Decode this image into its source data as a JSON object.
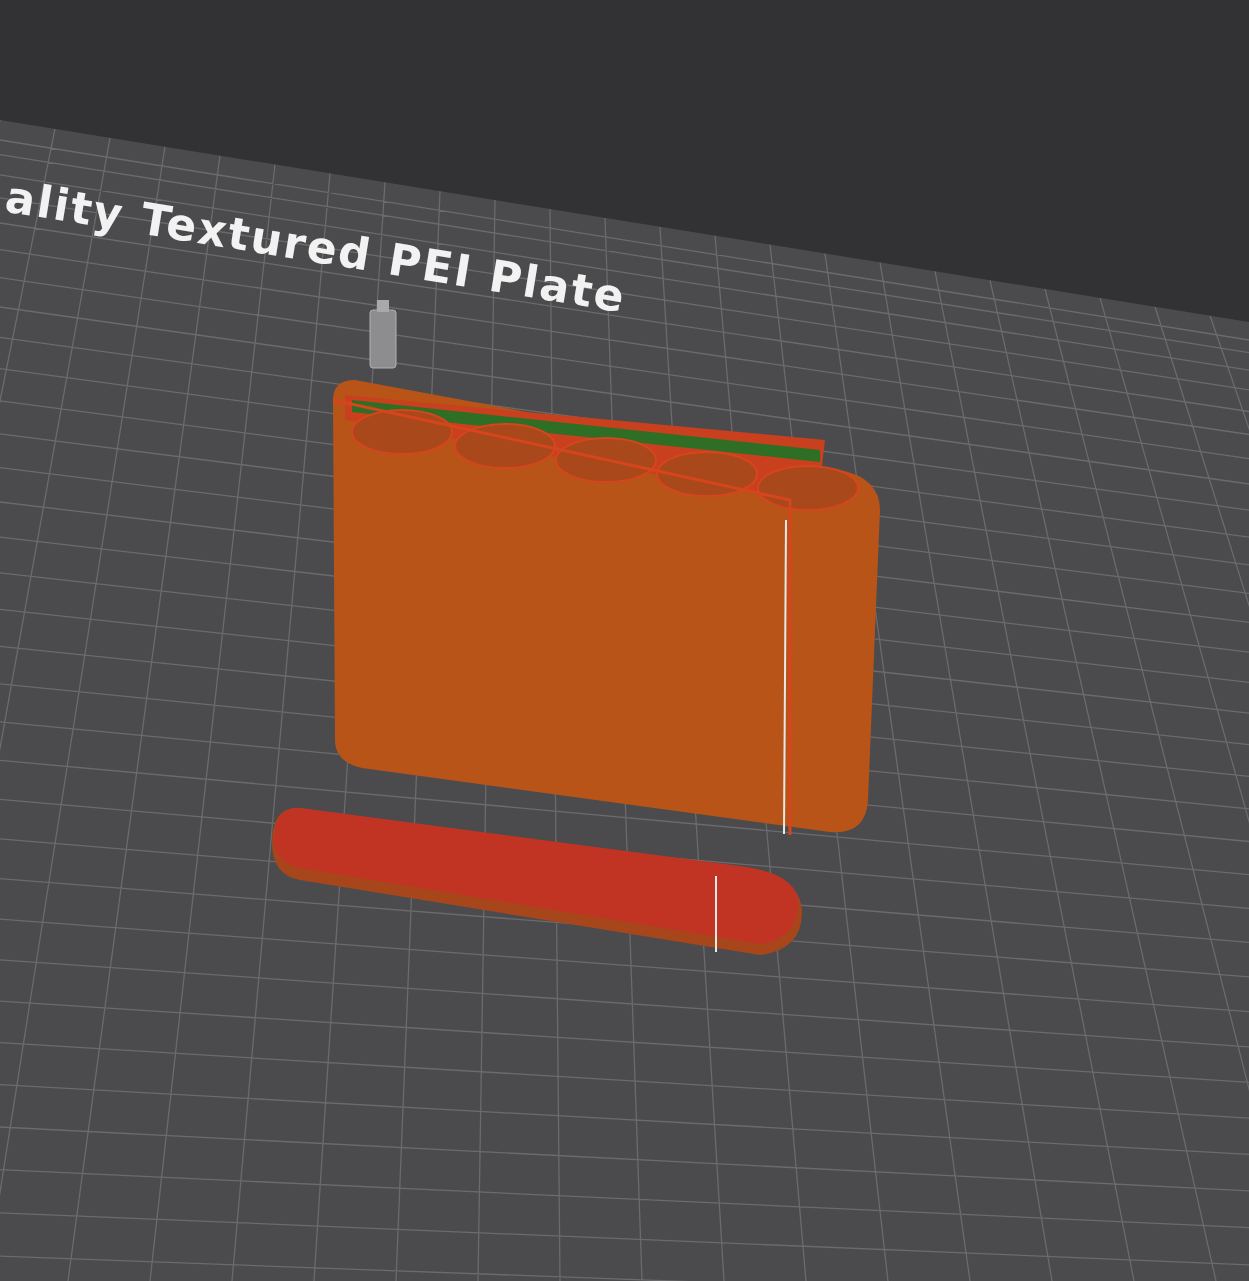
{
  "plate": {
    "label": "ality Textured PEI Plate"
  }
}
